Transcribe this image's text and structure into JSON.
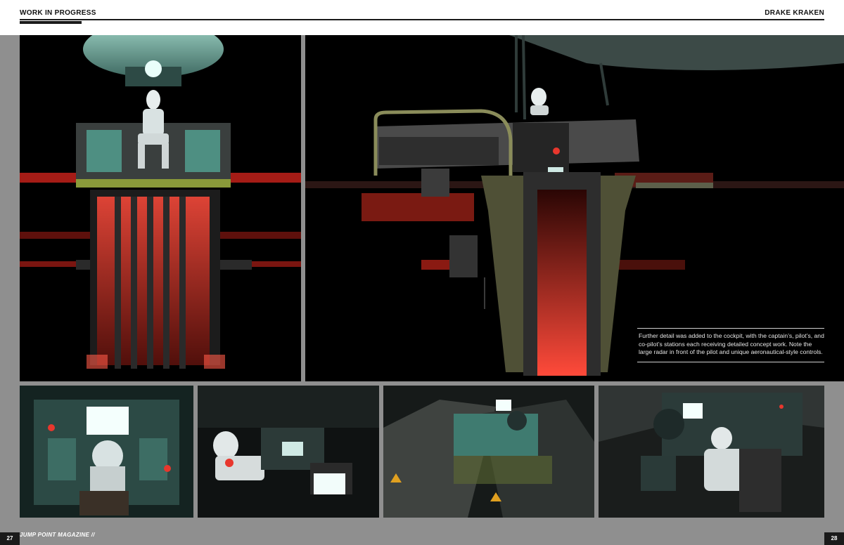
{
  "header": {
    "left_title": "WORK IN PROGRESS",
    "right_title": "DRAKE KRAKEN"
  },
  "caption": {
    "text": "Further detail was added to the cockpit, with the captain’s, pilot’s, and co-pilot’s stations each receiving detailed concept work. Note the large radar in front of the pilot and unique aeronautical-style controls."
  },
  "footer": {
    "magazine": "JUMP POINT MAGAZINE //",
    "page_left": "27",
    "page_right": "28"
  },
  "images": [
    {
      "name": "cockpit-front-render",
      "icon": "render-image"
    },
    {
      "name": "cockpit-side-render",
      "icon": "render-image"
    },
    {
      "name": "pilot-view-render-1",
      "icon": "render-image"
    },
    {
      "name": "pilot-view-render-2",
      "icon": "render-image"
    },
    {
      "name": "pilot-view-render-3",
      "icon": "render-image"
    },
    {
      "name": "pilot-view-render-4",
      "icon": "render-image"
    }
  ],
  "colors": {
    "accent_red": "#e8372d",
    "teal": "#6aa79a",
    "panel_bg": "#000000",
    "page_bg": "#8f8f8f"
  }
}
